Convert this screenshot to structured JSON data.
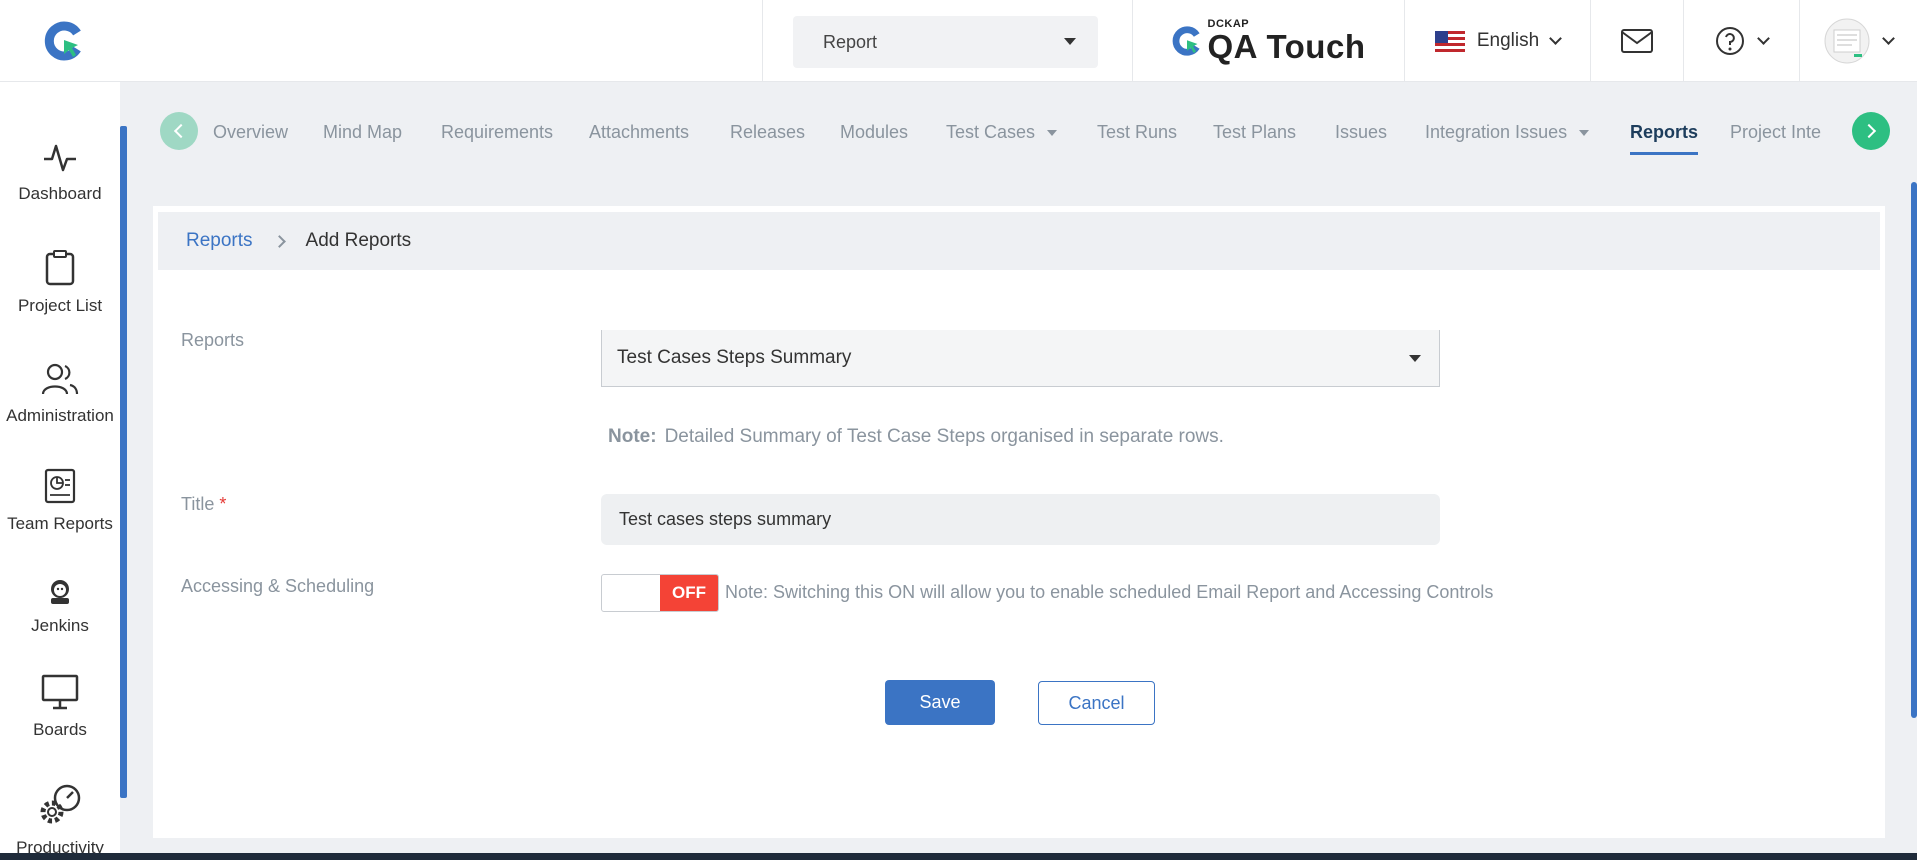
{
  "header": {
    "project_select": "Report",
    "brand_small": "DCKAP",
    "brand_name": "QA Touch",
    "language": "English"
  },
  "sidebar": {
    "items": [
      {
        "label": "Dashboard",
        "icon": "activity-icon"
      },
      {
        "label": "Project List",
        "icon": "clipboard-icon"
      },
      {
        "label": "Administration",
        "icon": "users-icon"
      },
      {
        "label": "Team Reports",
        "icon": "report-icon"
      },
      {
        "label": "Jenkins",
        "icon": "jenkins-icon"
      },
      {
        "label": "Boards",
        "icon": "presentation-board-icon"
      },
      {
        "label": "Productivity",
        "icon": "gear-speed-icon"
      }
    ]
  },
  "tabs": [
    {
      "label": "Overview"
    },
    {
      "label": "Mind Map"
    },
    {
      "label": "Requirements"
    },
    {
      "label": "Attachments"
    },
    {
      "label": "Releases"
    },
    {
      "label": "Modules"
    },
    {
      "label": "Test Cases"
    },
    {
      "label": "Test Runs"
    },
    {
      "label": "Test Plans"
    },
    {
      "label": "Issues"
    },
    {
      "label": "Integration Issues"
    },
    {
      "label": "Reports"
    },
    {
      "label": "Project Inte"
    }
  ],
  "breadcrumb": {
    "parent": "Reports",
    "current": "Add Reports"
  },
  "form": {
    "reports_label": "Reports",
    "reports_value": "Test Cases Steps Summary",
    "note_label": "Note:",
    "note_text": "Detailed Summary of Test Case Steps organised in separate rows.",
    "title_label": "Title",
    "title_required": "*",
    "title_value": "Test cases steps summary",
    "access_label": "Accessing & Scheduling",
    "toggle_state": "OFF",
    "toggle_note": "Note: Switching this ON will allow you to enable scheduled Email Report and Accessing Controls",
    "save_label": "Save",
    "cancel_label": "Cancel"
  },
  "colors": {
    "accent": "#3b74c4",
    "toggle_off": "#f44336",
    "nav_next": "#2dbf82"
  }
}
